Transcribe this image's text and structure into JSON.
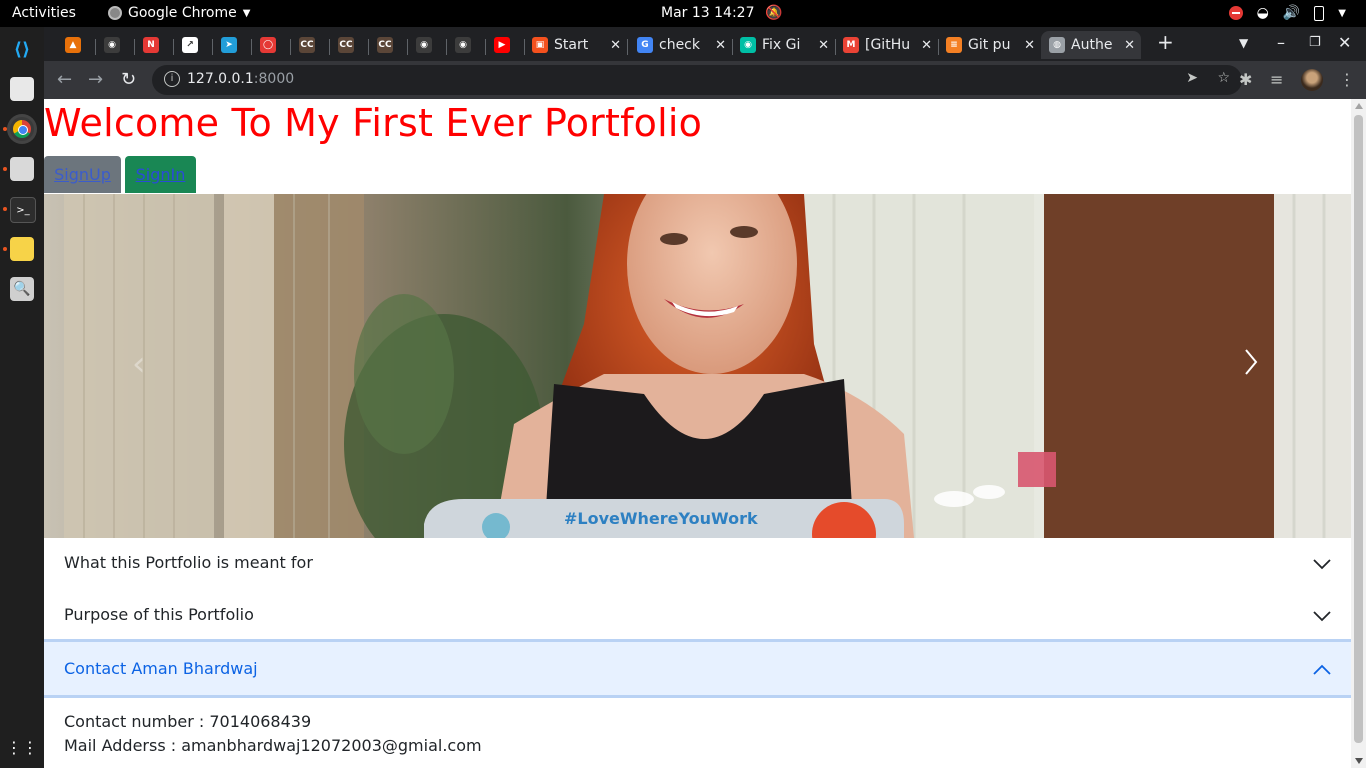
{
  "system": {
    "activities": "Activities",
    "app_name": "Google Chrome",
    "clock": "Mar 13  14:27"
  },
  "tabs": [
    {
      "title": "",
      "icon": "extension-fox-icon",
      "color": "#e8710a"
    },
    {
      "title": "",
      "icon": "github-icon",
      "color": "#3c3c3c"
    },
    {
      "title": "",
      "icon": "notion-icon",
      "color": "#e53935"
    },
    {
      "title": "",
      "icon": "chart-app-icon",
      "color": "#ffffff"
    },
    {
      "title": "",
      "icon": "telegram-icon",
      "color": "#229ed9"
    },
    {
      "title": "",
      "icon": "oracle-icon",
      "color": "#e53935"
    },
    {
      "title": "",
      "icon": "codechef-icon",
      "color": "#5b4638"
    },
    {
      "title": "",
      "icon": "codechef-icon",
      "color": "#5b4638"
    },
    {
      "title": "",
      "icon": "codechef-icon",
      "color": "#5b4638"
    },
    {
      "title": "",
      "icon": "github-icon",
      "color": "#3c3c3c"
    },
    {
      "title": "",
      "icon": "github-icon",
      "color": "#3c3c3c"
    },
    {
      "title": "",
      "icon": "youtube-icon",
      "color": "#ff0000"
    },
    {
      "title": "Start",
      "icon": "gift-icon",
      "color": "#f4511e"
    },
    {
      "title": "check",
      "icon": "google-icon",
      "color": "#4285f4"
    },
    {
      "title": "Fix Gi",
      "icon": "eye-icon",
      "color": "#00bfa5"
    },
    {
      "title": "[GitHu",
      "icon": "gmail-icon",
      "color": "#ea4335"
    },
    {
      "title": "Git pu",
      "icon": "stackoverflow-icon",
      "color": "#f48024"
    },
    {
      "title": "Authe",
      "icon": "globe-icon",
      "color": "#9aa0a6"
    }
  ],
  "address_bar": {
    "host": "127.0.0.1",
    "port": ":8000"
  },
  "page": {
    "heading": "Welcome To My First Ever Portfolio",
    "signup": "SignUp",
    "signin": "SignIn",
    "carousel_image": "woman-smiling-at-laptop-photo",
    "laptop_sticker": "#LoveWhereYouWork",
    "accordion": [
      {
        "title": "What this Portfolio is meant for",
        "expanded": false
      },
      {
        "title": "Purpose of this Portfolio",
        "expanded": false
      },
      {
        "title": "Contact Aman Bhardwaj",
        "expanded": true
      }
    ],
    "contact": {
      "phone_line": "Contact number : 7014068439",
      "mail_line": "Mail Adderss : amanbhardwaj12072003@gmial.com"
    }
  },
  "colors": {
    "heading": "#ff0000",
    "signup_bg": "#6c757d",
    "signin_bg": "#198754",
    "accordion_active_bg": "#e7f1ff",
    "accordion_active_text": "#0c63e4"
  }
}
